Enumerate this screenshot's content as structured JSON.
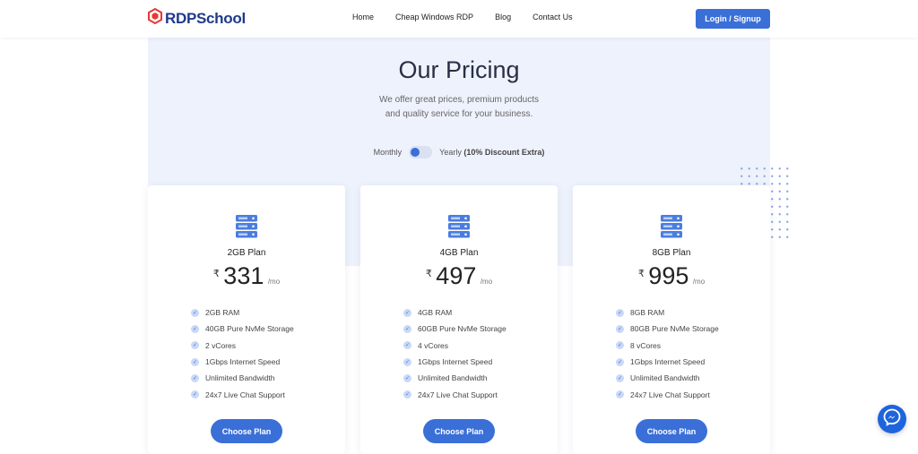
{
  "header": {
    "logo_text": "RDPSchool",
    "nav": [
      "Home",
      "Cheap Windows RDP",
      "Blog",
      "Contact Us"
    ],
    "login_label": "Login / Signup"
  },
  "pricing": {
    "title": "Our Pricing",
    "subtitle_line1": "We offer great prices, premium products",
    "subtitle_line2": "and quality service for your business.",
    "toggle_monthly": "Monthly",
    "toggle_yearly": "Yearly",
    "toggle_discount": "(10% Discount Extra)",
    "billing_selected": "Monthly"
  },
  "plans": [
    {
      "name": "2GB Plan",
      "currency": "₹",
      "price": "331",
      "per": "/mo",
      "features": [
        "2GB RAM",
        "40GB Pure NvMe Storage",
        "2 vCores",
        "1Gbps Internet Speed",
        "Unlimited Bandwidth",
        "24x7 Live Chat Support"
      ],
      "button": "Choose Plan"
    },
    {
      "name": "4GB Plan",
      "currency": "₹",
      "price": "497",
      "per": "/mo",
      "features": [
        "4GB RAM",
        "60GB Pure NvMe Storage",
        "4 vCores",
        "1Gbps Internet Speed",
        "Unlimited Bandwidth",
        "24x7 Live Chat Support"
      ],
      "button": "Choose Plan"
    },
    {
      "name": "8GB Plan",
      "currency": "₹",
      "price": "995",
      "per": "/mo",
      "features": [
        "8GB RAM",
        "80GB Pure NvMe Storage",
        "8 vCores",
        "1Gbps Internet Speed",
        "Unlimited Bandwidth",
        "24x7 Live Chat Support"
      ],
      "button": "Choose Plan"
    }
  ],
  "icons": {
    "logo": "rdpschool-logo-icon",
    "plan": "server-stack-icon",
    "feature": "check-circle-icon",
    "chat": "messenger-icon"
  },
  "colors": {
    "accent": "#3a6fd8",
    "brand_logo": "#e53935",
    "band_bg": "#eef2fc",
    "messenger": "#1e64dc"
  }
}
